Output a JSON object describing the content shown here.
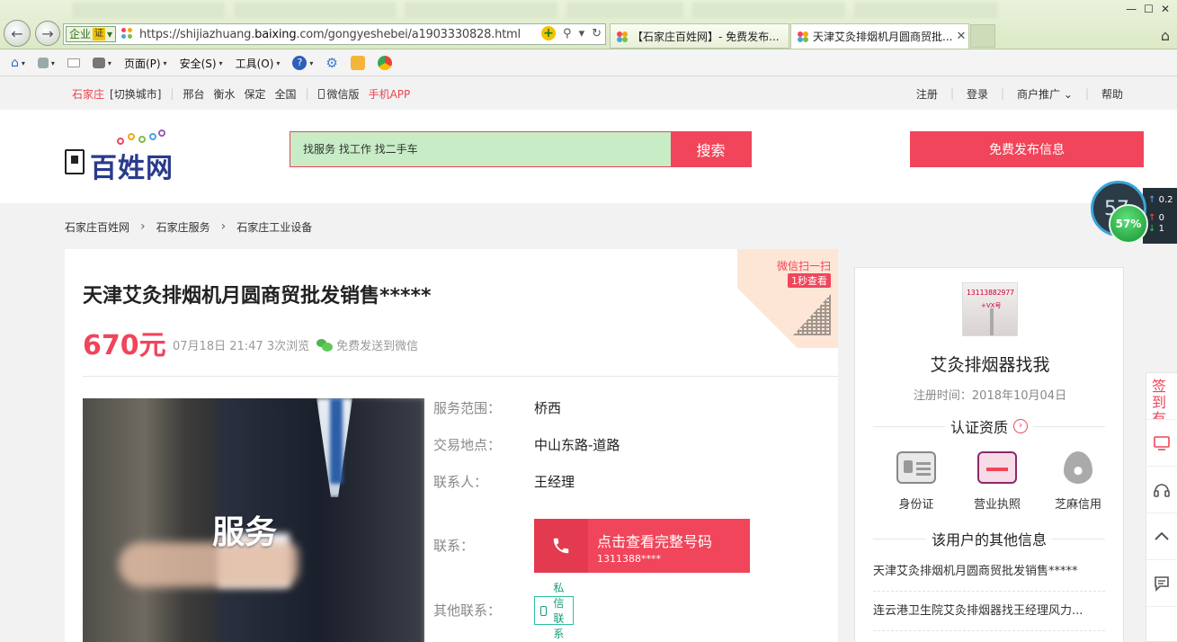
{
  "browser": {
    "address": {
      "verified_label": "企业",
      "verified_badge": "证",
      "url_prefix": "https://shijiazhuang.",
      "url_domain": "baixing",
      "url_suffix": ".com/gongyeshebei/a1903330828.html"
    },
    "tabs": [
      {
        "title": "【石家庄百姓网】- 免费发布..."
      },
      {
        "title": "天津艾灸排烟机月圆商贸批..."
      }
    ],
    "toolbar": {
      "page": "页面(P)",
      "safety": "安全(S)",
      "tools": "工具(O)"
    }
  },
  "speed_widget": {
    "outer_value": "57",
    "percent": "57%",
    "rate_top": "0.2",
    "rate_up": "0",
    "rate_down": "1"
  },
  "topbar": {
    "city": "石家庄",
    "switch_city": "[切换城市]",
    "cities": [
      "邢台",
      "衡水",
      "保定",
      "全国"
    ],
    "wechat": "微信版",
    "app": "手机APP",
    "right": [
      "注册",
      "登录",
      "商户推广",
      "帮助"
    ]
  },
  "header": {
    "logo_text": "百姓网",
    "search_placeholder": "找服务 找工作 找二手车",
    "search_button": "搜索",
    "publish_button": "免费发布信息"
  },
  "breadcrumb": [
    "石家庄百姓网",
    "石家庄服务",
    "石家庄工业设备"
  ],
  "listing": {
    "title": "天津艾灸排烟机月圆商贸批发销售*****",
    "price": "670元",
    "meta": "07月18日 21:47 3次浏览",
    "send_wechat": "免费发送到微信",
    "qr_scan": "微信扫一扫",
    "qr_second": "1秒查看",
    "photo_label": "服务",
    "fields": [
      {
        "key": "服务范围：",
        "value": "桥西"
      },
      {
        "key": "交易地点：",
        "value": "中山东路-道路"
      },
      {
        "key": "联系人：",
        "value": "王经理"
      }
    ],
    "contact_key": "联系：",
    "call_title": "点击查看完整号码",
    "call_number": "1311388****",
    "other_contact_key": "其他联系：",
    "pm_button": "私信联系"
  },
  "seller": {
    "avatar_text1": "13113882977",
    "avatar_text2": "+VX号",
    "name": "艾灸排烟器找我",
    "reg_time": "注册时间：2018年10月04日",
    "cert_title": "认证资质",
    "certs": [
      "身份证",
      "营业执照",
      "芝麻信用"
    ],
    "other_title": "该用户的其他信息",
    "other_items": [
      "天津艾灸排烟机月圆商贸批发销售*****",
      "连云港卫生院艾灸排烟器找王经理风力..."
    ]
  },
  "float_side": {
    "sign": "签到有"
  },
  "colors": {
    "brand_red": "#f0455a",
    "search_bg": "#c7ecc6",
    "logo_blue": "#2a3a8c",
    "teal": "#179b7d"
  }
}
